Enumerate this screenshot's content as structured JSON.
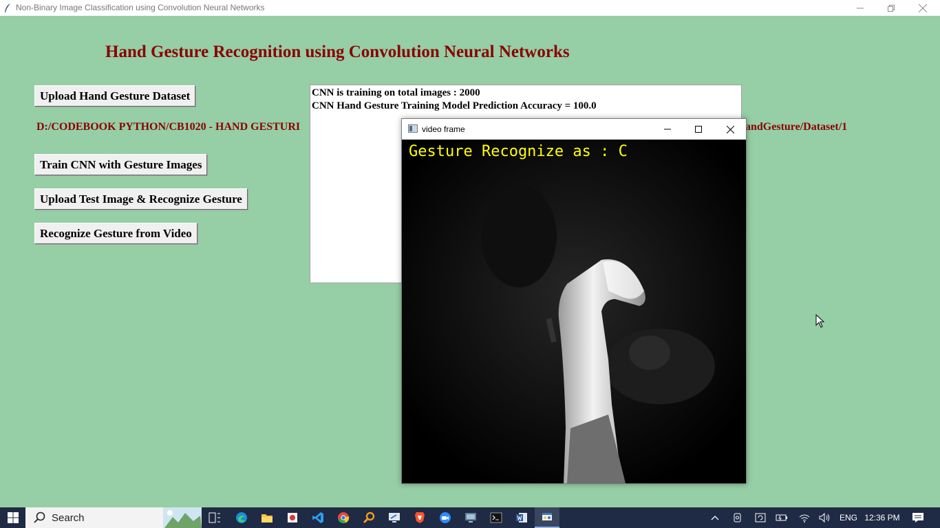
{
  "window": {
    "title": "Non-Binary Image Classification using Convolution Neural Networks"
  },
  "app": {
    "heading": "Hand Gesture Recognition using Convolution Neural Networks",
    "buttons": {
      "upload_dataset": "Upload Hand Gesture Dataset",
      "train_cnn": "Train CNN with Gesture Images",
      "upload_test": "Upload Test Image & Recognize Gesture",
      "video": "Recognize Gesture from Video"
    },
    "path_left": "D:/CODEBOOK PYTHON/CB1020 - HAND GESTURI",
    "path_right": "andGesture/Dataset/1",
    "output_lines": [
      "CNN is training on total images : 2000",
      "CNN Hand Gesture Training Model Prediction Accuracy = 100.0"
    ]
  },
  "video_window": {
    "title": "video frame",
    "overlay_label": "Gesture Recognize as : C"
  },
  "taskbar": {
    "search_label": "Search",
    "language": "ENG",
    "time": "12:36 PM"
  },
  "colors": {
    "background": "#96cea6",
    "heading": "#8b0000",
    "overlay_text": "#ffff00",
    "taskbar": "#1f2a44"
  }
}
